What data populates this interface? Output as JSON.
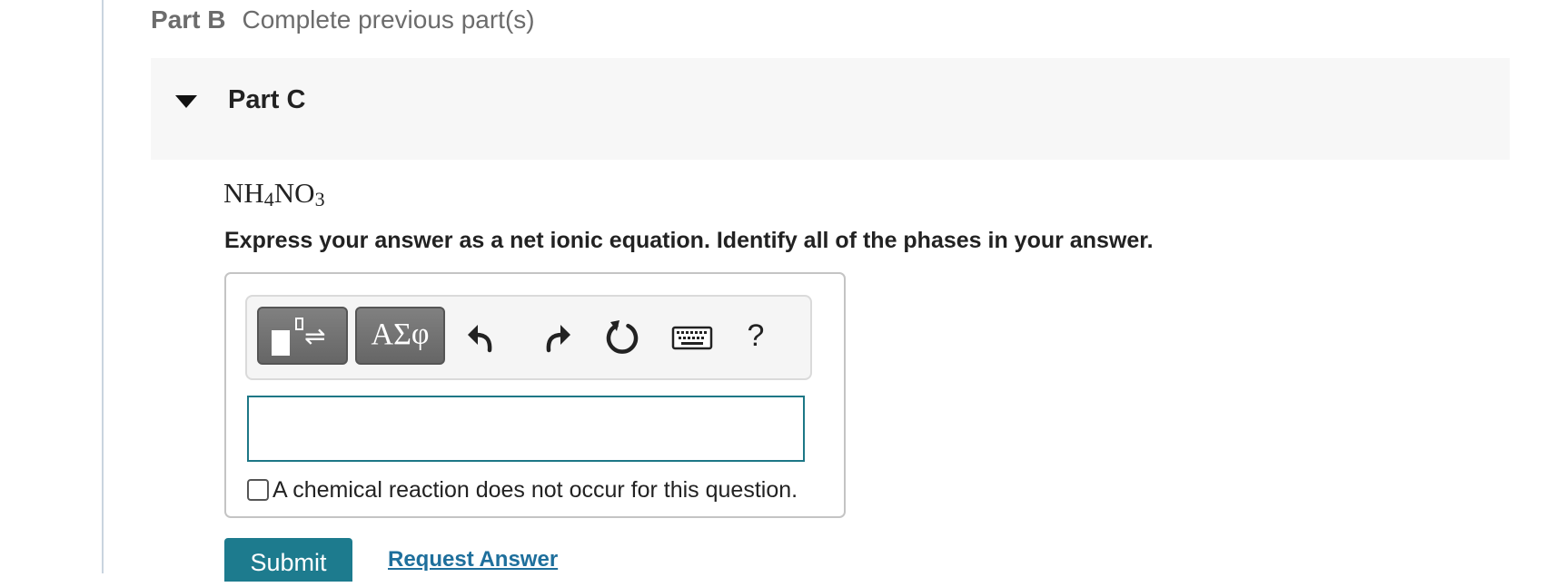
{
  "part_b": {
    "label": "Part B",
    "status": "Complete previous part(s)"
  },
  "part_c": {
    "label": "Part C",
    "expanded": true
  },
  "question": {
    "formula_parts": [
      "NH",
      "4",
      "NO",
      "3"
    ],
    "instruction": "Express your answer as a net ionic equation. Identify all of the phases in your answer."
  },
  "toolbar": {
    "buttons": [
      {
        "icon": "templates-icon"
      },
      {
        "label": "ΑΣφ",
        "icon": "greek-symbols-icon"
      },
      {
        "icon": "undo-icon"
      },
      {
        "icon": "redo-icon"
      },
      {
        "icon": "reset-icon"
      },
      {
        "icon": "keyboard-icon"
      },
      {
        "label": "?",
        "icon": "help-icon"
      }
    ],
    "eq_arrows": "⇌"
  },
  "answer": {
    "value": ""
  },
  "no_reaction": {
    "label": "A chemical reaction does not occur for this question.",
    "checked": false
  },
  "actions": {
    "submit_label": "Submit",
    "request_answer_label": "Request Answer"
  },
  "colors": {
    "accent": "#1d7b8e",
    "link": "#1e6f9c",
    "input_border": "#1d7786",
    "button_gray": "#6e6e6e"
  }
}
